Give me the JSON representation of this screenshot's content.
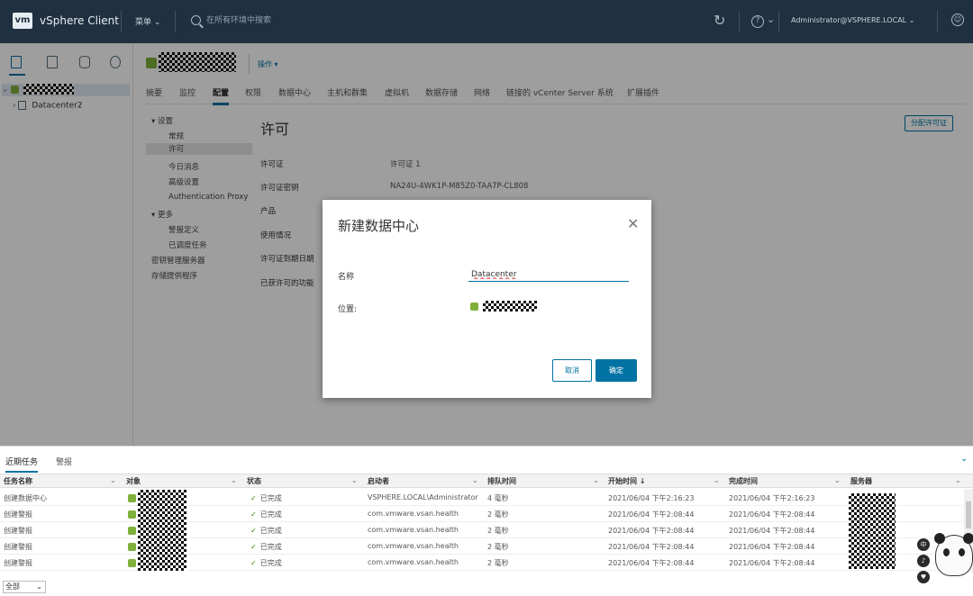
{
  "topbar": {
    "logo": "vm",
    "app_title": "vSphere Client",
    "menu_label": "菜单",
    "search_placeholder": "在所有环境中搜索",
    "user": "Administrator@VSPHERE.LOCAL"
  },
  "tree": {
    "datacenter2": "Datacenter2"
  },
  "object_header": {
    "actions_label": "操作"
  },
  "tabs": [
    "摘要",
    "监控",
    "配置",
    "权限",
    "数据中心",
    "主机和群集",
    "虚拟机",
    "数据存储",
    "网络",
    "链接的 vCenter Server 系统",
    "扩展插件"
  ],
  "subnav": {
    "settings": "设置",
    "general": "常规",
    "licensing": "许可",
    "motd": "今日消息",
    "advanced": "高级设置",
    "auth_proxy": "Authentication Proxy",
    "more": "更多",
    "alarm_defs": "警报定义",
    "scheduled": "已调度任务",
    "kms": "密钥管理服务器",
    "storage_providers": "存储提供程序"
  },
  "main": {
    "title": "许可",
    "assign_button": "分配许可证",
    "props": [
      {
        "label": "许可证",
        "value": "许可证 1"
      },
      {
        "label": "许可证密钥",
        "value": "NA24U-4WK1P-M85Z0-TAA7P-CL808"
      },
      {
        "label": "产品",
        "value": ""
      },
      {
        "label": "使用情况",
        "value": ""
      },
      {
        "label": "许可证到期日期",
        "value": ""
      },
      {
        "label": "已获许可的功能",
        "value": ""
      }
    ]
  },
  "modal": {
    "title": "新建数据中心",
    "name_label": "名称",
    "name_value": "Datacenter",
    "location_label": "位置:",
    "cancel": "取消",
    "ok": "确定"
  },
  "bottom": {
    "tab_recent": "近期任务",
    "tab_alarms": "警报",
    "columns": [
      "任务名称",
      "对象",
      "状态",
      "启动者",
      "排队时间",
      "开始时间 ↓",
      "完成时间",
      "服务器"
    ],
    "rows": [
      {
        "task": "创建数据中心",
        "status": "已完成",
        "initiator": "VSPHERE.LOCAL\\Administrator",
        "queued": "4 毫秒",
        "start": "2021/06/04 下午2:16:23",
        "end": "2021/06/04 下午2:16:23"
      },
      {
        "task": "创建警报",
        "status": "已完成",
        "initiator": "com.vmware.vsan.health",
        "queued": "2 毫秒",
        "start": "2021/06/04 下午2:08:44",
        "end": "2021/06/04 下午2:08:44"
      },
      {
        "task": "创建警报",
        "status": "已完成",
        "initiator": "com.vmware.vsan.health",
        "queued": "2 毫秒",
        "start": "2021/06/04 下午2:08:44",
        "end": "2021/06/04 下午2:08:44"
      },
      {
        "task": "创建警报",
        "status": "已完成",
        "initiator": "com.vmware.vsan.health",
        "queued": "2 毫秒",
        "start": "2021/06/04 下午2:08:44",
        "end": "2021/06/04 下午2:08:44"
      },
      {
        "task": "创建警报",
        "status": "已完成",
        "initiator": "com.vmware.vsan.health",
        "queued": "2 毫秒",
        "start": "2021/06/04 下午2:08:44",
        "end": "2021/06/04 下午2:08:44"
      }
    ],
    "filter_select": "全部"
  },
  "widget": {
    "c1": "中",
    "c2": "♪",
    "c3": "♥"
  },
  "colors": {
    "topbar": "#1f3040",
    "accent": "#0072a3",
    "success": "#2f8400"
  }
}
